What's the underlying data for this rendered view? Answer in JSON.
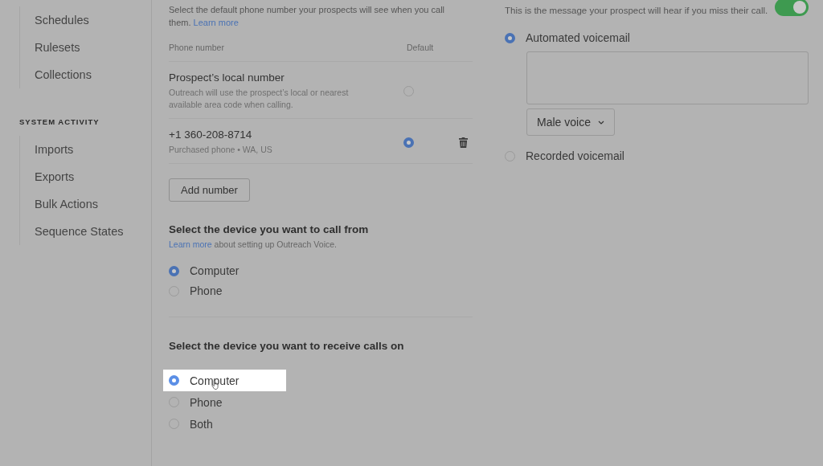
{
  "sidebar": {
    "groups": [
      {
        "items": [
          {
            "label": "Schedules"
          },
          {
            "label": "Rulesets"
          },
          {
            "label": "Collections"
          }
        ]
      },
      {
        "heading": "SYSTEM ACTIVITY",
        "items": [
          {
            "label": "Imports"
          },
          {
            "label": "Exports"
          },
          {
            "label": "Bulk Actions"
          },
          {
            "label": "Sequence States"
          }
        ]
      }
    ]
  },
  "phone_numbers": {
    "intro": "Select the default phone number your prospects will see when you call them.",
    "intro_link": "Learn more",
    "columns": [
      "Phone number",
      "Default"
    ],
    "rows": [
      {
        "title": "Prospect’s local number",
        "subtitle": "Outreach will use the prospect’s local or nearest available area code when calling.",
        "selected": false,
        "deletable": false
      },
      {
        "title": "+1 360-208-8714",
        "subtitle": "Purchased phone • WA, US",
        "selected": true,
        "deletable": true
      }
    ],
    "add_button": "Add number"
  },
  "call_from": {
    "title": "Select the device you want to call from",
    "help_link": "Learn more",
    "help_text": "about setting up Outreach Voice.",
    "options": [
      {
        "label": "Computer",
        "selected": true
      },
      {
        "label": "Phone",
        "selected": false
      }
    ]
  },
  "receive_on": {
    "title": "Select the device you want to receive calls on",
    "options": [
      {
        "label": "Computer",
        "selected": true,
        "highlighted": true
      },
      {
        "label": "Phone",
        "selected": false,
        "highlighted": false
      },
      {
        "label": "Both",
        "selected": false,
        "highlighted": false
      }
    ]
  },
  "voicemail": {
    "description": "This is the message your prospect will hear if you miss their call.",
    "on": true,
    "options": [
      {
        "label": "Automated voicemail",
        "selected": true,
        "kind": "automated"
      },
      {
        "label": "Recorded voicemail",
        "selected": false,
        "kind": "recorded"
      }
    ],
    "voice_select": "Male voice"
  }
}
